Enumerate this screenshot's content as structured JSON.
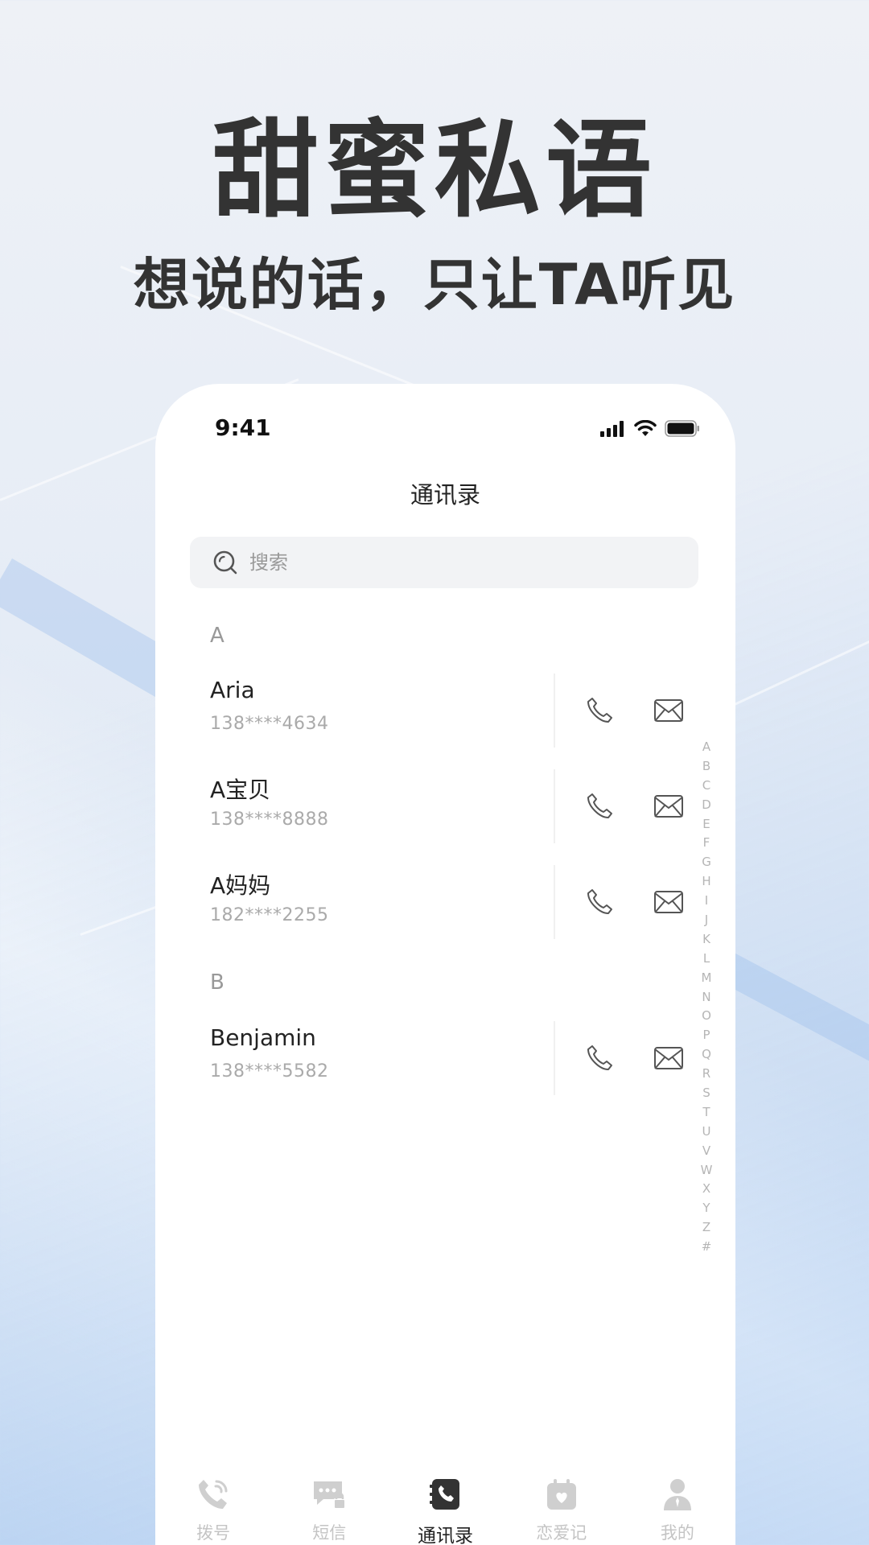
{
  "hero": {
    "title": "甜蜜私语",
    "subtitle": "想说的话，只让TA听见"
  },
  "status_bar": {
    "time": "9:41",
    "icons": [
      "cellular-signal-icon",
      "wifi-icon",
      "battery-icon"
    ]
  },
  "page": {
    "title": "通讯录"
  },
  "search": {
    "placeholder": "搜索",
    "icon": "search-icon"
  },
  "sections": [
    {
      "letter": "A",
      "contacts": [
        {
          "name": "Aria",
          "phone": "138****4634"
        },
        {
          "name": "A宝贝",
          "phone": "138****8888"
        },
        {
          "name": "A妈妈",
          "phone": "182****2255"
        }
      ]
    },
    {
      "letter": "B",
      "contacts": [
        {
          "name": "Benjamin",
          "phone": "138****5582"
        }
      ]
    }
  ],
  "alpha_index": [
    "A",
    "B",
    "C",
    "D",
    "E",
    "F",
    "G",
    "H",
    "I",
    "J",
    "K",
    "L",
    "M",
    "N",
    "O",
    "P",
    "Q",
    "R",
    "S",
    "T",
    "U",
    "V",
    "W",
    "X",
    "Y",
    "Z",
    "#"
  ],
  "tabs": [
    {
      "label": "拨号",
      "icon": "phone-dial-icon",
      "active": false
    },
    {
      "label": "短信",
      "icon": "locked-message-icon",
      "active": false
    },
    {
      "label": "通讯录",
      "icon": "contacts-book-icon",
      "active": true
    },
    {
      "label": "恋爱记",
      "icon": "calendar-heart-icon",
      "active": false
    },
    {
      "label": "我的",
      "icon": "user-profile-icon",
      "active": false
    }
  ],
  "colors": {
    "text_primary": "#222222",
    "text_secondary": "#aaaaaa",
    "tab_inactive": "#c4c4c4",
    "search_bg": "#f2f3f5"
  }
}
